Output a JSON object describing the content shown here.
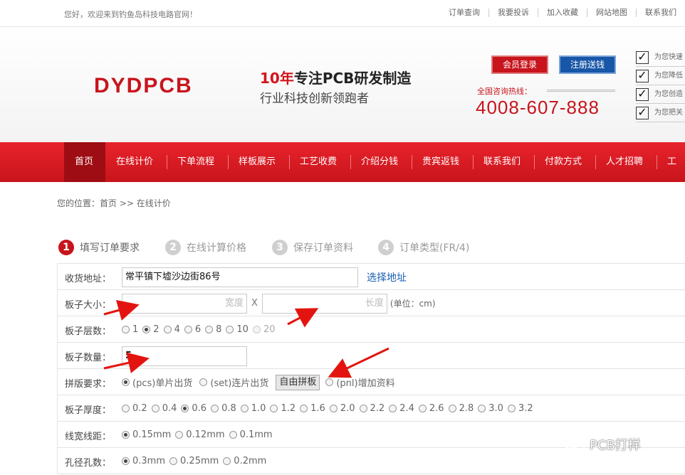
{
  "topbar": {
    "welcome": "您好，欢迎来到钓鱼岛科技电路官网！",
    "links": [
      "订单查询",
      "我要投诉",
      "加入收藏",
      "网站地图",
      "联系我们"
    ]
  },
  "header": {
    "logo": "DYDPCB",
    "slogan_red": "10年",
    "slogan_rest": "专注PCB研发制造",
    "slogan2": "行业科技创新领跑者",
    "login_button": "会员登录",
    "register_button": "注册送钱",
    "hotline_label": "全国咨询热线：",
    "hotline": "4008-607-888",
    "promises": [
      "为您快速",
      "为您降低",
      "为您创造",
      "为您把关"
    ]
  },
  "nav": {
    "items": [
      "首页",
      "在线计价",
      "下单流程",
      "样板展示",
      "工艺收费",
      "介绍分钱",
      "贵宾返钱",
      "联系我们",
      "付款方式",
      "人才招聘",
      "工程"
    ],
    "active_index": 0
  },
  "breadcrumb": "您的位置：首页 >> 在线计价",
  "steps": [
    {
      "num": "1",
      "label": "填写订单要求"
    },
    {
      "num": "2",
      "label": "在线计算价格"
    },
    {
      "num": "3",
      "label": "保存订单资料"
    },
    {
      "num": "4",
      "label": "订单类型(FR/4)"
    }
  ],
  "form": {
    "address": {
      "label": "收货地址：",
      "value": "常平镇下墟沙边街86号",
      "link": "选择地址"
    },
    "size": {
      "label": "板子大小：",
      "width_placeholder": "宽度",
      "times": "X",
      "length_placeholder": "长度",
      "unit": "(单位：cm)"
    },
    "layers": {
      "label": "板子层数：",
      "options": [
        "1",
        "2",
        "4",
        "6",
        "8",
        "10",
        "20"
      ],
      "selected": "2"
    },
    "quantity": {
      "label": "板子数量：",
      "value": "5"
    },
    "panel": {
      "label": "拼版要求：",
      "opt1": "(pcs)单片出货",
      "opt2": "(set)连片出货",
      "free_box": "自由拼板",
      "opt3": "(pnl)增加资料",
      "selected": "opt1"
    },
    "thickness": {
      "label": "板子厚度：",
      "options": [
        "0.2",
        "0.4",
        "0.6",
        "0.8",
        "1.0",
        "1.2",
        "1.6",
        "2.0",
        "2.2",
        "2.4",
        "2.6",
        "2.8",
        "3.0",
        "3.2"
      ],
      "selected": "0.6"
    },
    "trace": {
      "label": "线宽线距：",
      "options": [
        "0.15mm",
        "0.12mm",
        "0.1mm"
      ],
      "selected": "0.15mm"
    },
    "hole": {
      "label": "孔径孔数：",
      "options": [
        "0.3mm",
        "0.25mm",
        "0.2mm"
      ],
      "selected": "0.3mm"
    }
  },
  "watermark": "PCB打样",
  "colors": {
    "brand_red": "#c8141c",
    "nav_active": "#9e0d13",
    "register_blue": "#1857a8",
    "link_blue": "#1a5fb4"
  }
}
